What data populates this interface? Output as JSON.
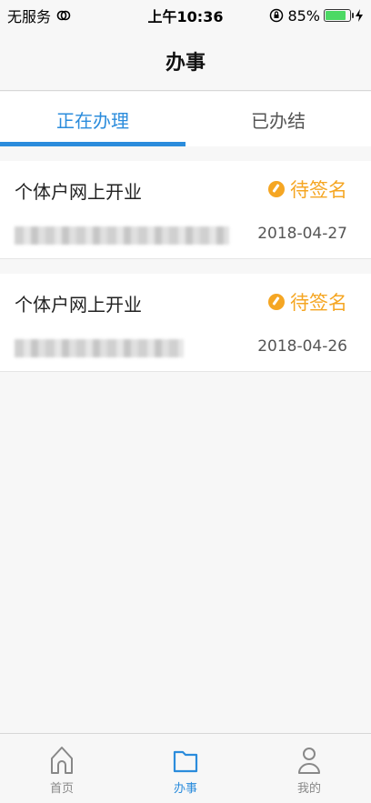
{
  "status_bar": {
    "carrier": "无服务",
    "time": "上午10:36",
    "battery_percent": "85%",
    "battery_level": 0.85
  },
  "nav": {
    "title": "办事"
  },
  "tabs": [
    {
      "label": "正在办理",
      "active": true
    },
    {
      "label": "已办结",
      "active": false
    }
  ],
  "items": [
    {
      "title": "个体户网上开业",
      "status": "待签名",
      "date": "2018-04-27"
    },
    {
      "title": "个体户网上开业",
      "status": "待签名",
      "date": "2018-04-26"
    }
  ],
  "tab_bar": [
    {
      "label": "首页",
      "icon": "home-icon",
      "active": false
    },
    {
      "label": "办事",
      "icon": "folder-icon",
      "active": true
    },
    {
      "label": "我的",
      "icon": "user-icon",
      "active": false
    }
  ],
  "colors": {
    "accent": "#2b8cdc",
    "pending": "#f5a623"
  }
}
